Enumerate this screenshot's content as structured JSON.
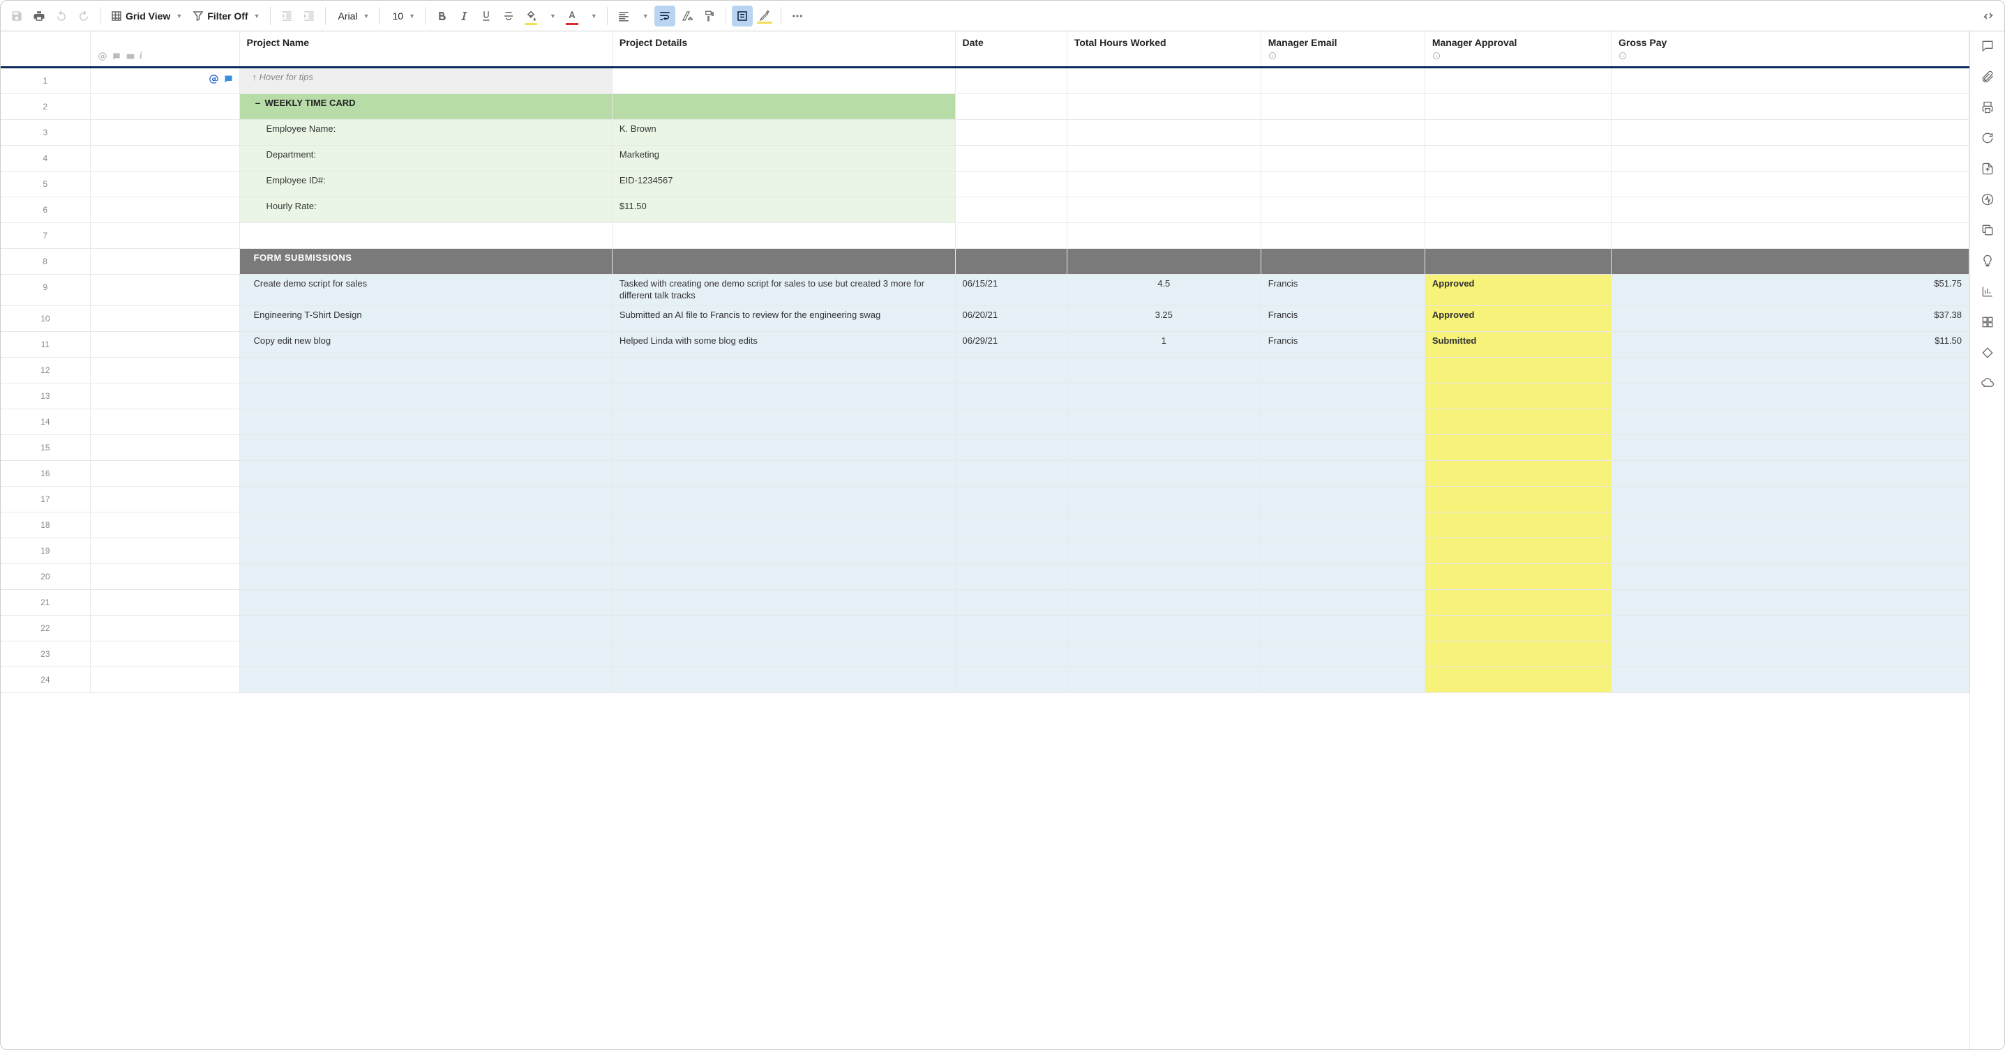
{
  "toolbar": {
    "grid_view": "Grid View",
    "filter_off": "Filter Off",
    "font_name": "Arial",
    "font_size": "10"
  },
  "headers": {
    "project_name": "Project Name",
    "project_details": "Project Details",
    "date": "Date",
    "total_hours": "Total Hours Worked",
    "manager_email": "Manager Email",
    "manager_approval": "Manager Approval",
    "gross_pay": "Gross Pay"
  },
  "hover_tip": "↑ Hover for tips",
  "section_title": "WEEKLY TIME CARD",
  "employee_info": [
    {
      "label": "Employee Name:",
      "value": "K. Brown"
    },
    {
      "label": "Department:",
      "value": "Marketing"
    },
    {
      "label": "Employee ID#:",
      "value": "EID-1234567"
    },
    {
      "label": "Hourly Rate:",
      "value": "$11.50"
    }
  ],
  "form_submissions_header": "FORM SUBMISSIONS",
  "submissions": [
    {
      "row": 9,
      "project": "Create demo script for sales",
      "details": "Tasked with creating one demo script for sales to use but created 3 more for different talk tracks",
      "date": "06/15/21",
      "hours": "4.5",
      "manager_email": "Francis",
      "approval": "Approved",
      "pay": "$51.75"
    },
    {
      "row": 10,
      "project": "Engineering T-Shirt Design",
      "details": "Submitted an AI file to Francis to review for the engineering swag",
      "date": "06/20/21",
      "hours": "3.25",
      "manager_email": "Francis",
      "approval": "Approved",
      "pay": "$37.38"
    },
    {
      "row": 11,
      "project": "Copy edit new blog",
      "details": "Helped Linda with some blog edits",
      "date": "06/29/21",
      "hours": "1",
      "manager_email": "Francis",
      "approval": "Submitted",
      "pay": "$11.50"
    }
  ],
  "empty_data_rows": [
    12,
    13,
    14,
    15,
    16,
    17,
    18,
    19,
    20,
    21,
    22,
    23,
    24
  ]
}
